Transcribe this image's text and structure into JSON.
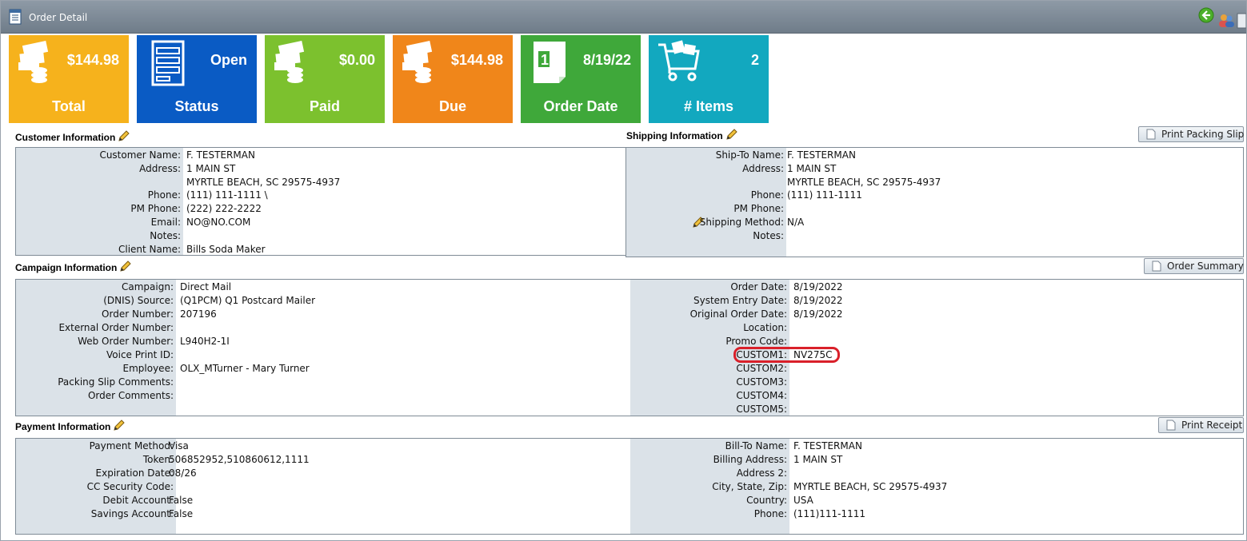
{
  "window": {
    "title": "Order Detail"
  },
  "tiles": [
    {
      "value": "$144.98",
      "label": "Total",
      "color": "#f6b21c",
      "icon": "money-stack-icon"
    },
    {
      "value": "Open",
      "label": "Status",
      "color": "#0a5bc4",
      "icon": "document-list-icon"
    },
    {
      "value": "$0.00",
      "label": "Paid",
      "color": "#7cc12e",
      "icon": "money-stack-icon"
    },
    {
      "value": "$144.98",
      "label": "Due",
      "color": "#f0861a",
      "icon": "money-stack-icon"
    },
    {
      "value": "8/19/22",
      "label": "Order Date",
      "color": "#3fa83a",
      "icon": "calendar-icon"
    },
    {
      "value": "2",
      "label": "# Items",
      "color": "#12a8bf",
      "icon": "shopping-cart-icon"
    }
  ],
  "customer": {
    "title": "Customer Information",
    "rows": [
      {
        "label": "Customer Name:",
        "value": "F. TESTERMAN"
      },
      {
        "label": "Address:",
        "value": "1 MAIN ST"
      },
      {
        "label": "",
        "value": "MYRTLE BEACH, SC 29575-4937"
      },
      {
        "label": "Phone:",
        "value": "(111) 111-1111 \\"
      },
      {
        "label": "PM Phone:",
        "value": "(222) 222-2222"
      },
      {
        "label": "Email:",
        "value": "NO@NO.COM"
      },
      {
        "label": "Notes:",
        "value": ""
      },
      {
        "label": "Client Name:",
        "value": "Bills Soda Maker"
      }
    ]
  },
  "shipping": {
    "title": "Shipping Information",
    "button": "Print Packing Slip",
    "rows": [
      {
        "label": "Ship-To Name:",
        "value": "F. TESTERMAN"
      },
      {
        "label": "Address:",
        "value": "1 MAIN ST"
      },
      {
        "label": "",
        "value": "MYRTLE BEACH, SC 29575-4937"
      },
      {
        "label": "Phone:",
        "value": "(111) 111-1111"
      },
      {
        "label": "PM Phone:",
        "value": ""
      },
      {
        "label": "Shipping Method:",
        "value": "N/A"
      },
      {
        "label": "Notes:",
        "value": ""
      }
    ]
  },
  "campaign": {
    "title": "Campaign Information",
    "button": "Order Summary",
    "left_rows": [
      {
        "label": "Campaign:",
        "value": "Direct Mail"
      },
      {
        "label": "(DNIS) Source:",
        "value": "(Q1PCM) Q1 Postcard Mailer"
      },
      {
        "label": "Order Number:",
        "value": "207196"
      },
      {
        "label": "External Order Number:",
        "value": ""
      },
      {
        "label": "Web Order Number:",
        "value": "L940H2-1I"
      },
      {
        "label": "Voice Print ID:",
        "value": ""
      },
      {
        "label": "Employee:",
        "value": "OLX_MTurner - Mary Turner"
      },
      {
        "label": "Packing Slip Comments:",
        "value": ""
      },
      {
        "label": "Order Comments:",
        "value": ""
      }
    ],
    "right_rows": [
      {
        "label": "Order Date:",
        "value": "8/19/2022"
      },
      {
        "label": "System Entry Date:",
        "value": "8/19/2022"
      },
      {
        "label": "Original Order Date:",
        "value": "8/19/2022"
      },
      {
        "label": "Location:",
        "value": ""
      },
      {
        "label": "Promo Code:",
        "value": ""
      },
      {
        "label": "CUSTOM1:",
        "value": "NV275C"
      },
      {
        "label": "CUSTOM2:",
        "value": ""
      },
      {
        "label": "CUSTOM3:",
        "value": ""
      },
      {
        "label": "CUSTOM4:",
        "value": ""
      },
      {
        "label": "CUSTOM5:",
        "value": ""
      }
    ]
  },
  "payment": {
    "title": "Payment Information",
    "button": "Print Receipt",
    "left_rows": [
      {
        "label": "Payment Method:",
        "value": "Visa"
      },
      {
        "label": "Token:",
        "value": "506852952,510860612,1111"
      },
      {
        "label": "Expiration Date:",
        "value": "08/26"
      },
      {
        "label": "CC Security Code:",
        "value": ""
      },
      {
        "label": "Debit Account:",
        "value": "False"
      },
      {
        "label": "Savings Account:",
        "value": "False"
      }
    ],
    "right_rows": [
      {
        "label": "Bill-To Name:",
        "value": "F. TESTERMAN"
      },
      {
        "label": "Billing Address:",
        "value": "1 MAIN ST"
      },
      {
        "label": "Address 2:",
        "value": ""
      },
      {
        "label": "City, State, Zip:",
        "value": "MYRTLE BEACH, SC 29575-4937"
      },
      {
        "label": "Country:",
        "value": "USA"
      },
      {
        "label": "Phone:",
        "value": "(111)111-1111"
      }
    ]
  },
  "colors": {
    "highlight": "#d9202a",
    "label_column": "#dbe2e8",
    "titlebar": "#7d8a97"
  },
  "icons": {
    "edit": "pencil-icon",
    "back": "back-arrow-icon",
    "print": "document-icon"
  }
}
